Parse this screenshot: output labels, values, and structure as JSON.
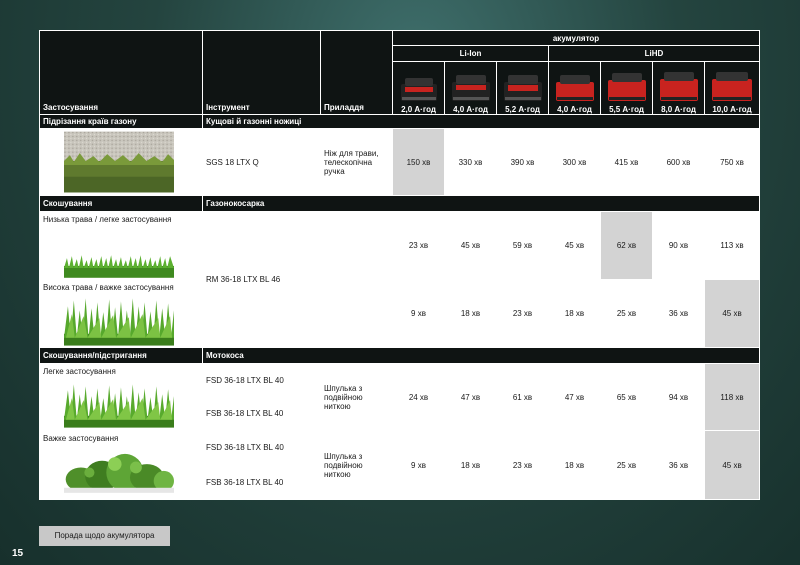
{
  "header": {
    "battery_group": "акумулятор",
    "liion": "Li-Ion",
    "lihd": "LiHD",
    "col_application": "Застосування",
    "col_tool": "Інструмент",
    "col_accessory": "Приладдя",
    "capacities": [
      "2,0 А·год",
      "4,0 А·год",
      "5,2 А·год",
      "4,0 А·год",
      "5,5 А·год",
      "8,0 А·год",
      "10,0 А·год"
    ]
  },
  "sections": {
    "s1": {
      "title": "Підрізання країв газону",
      "tool_group": "Кущові й газонні ножиці"
    },
    "s2": {
      "title": "Скошування",
      "tool_group": "Газонокосарка"
    },
    "s3": {
      "title": "Скошування/підстригання",
      "tool_group": "Мотокоса"
    }
  },
  "rows": {
    "r1": {
      "tool": "SGS 18 LTX Q",
      "accessory": "Ніж для трави, телескопічна ручка",
      "values": [
        "150 хв",
        "330 хв",
        "390 хв",
        "300 хв",
        "415 хв",
        "600 хв",
        "750 хв"
      ]
    },
    "r2": {
      "label": "Низька трава / легке застосування",
      "values": [
        "23 хв",
        "45 хв",
        "59 хв",
        "45 хв",
        "62 хв",
        "90 хв",
        "113 хв"
      ]
    },
    "r3": {
      "label": "Висока трава / важке застосування",
      "values": [
        "9 хв",
        "18 хв",
        "23 хв",
        "18 хв",
        "25 хв",
        "36 хв",
        "45 хв"
      ]
    },
    "mower_tool": "RM 36-18 LTX BL 46",
    "r4": {
      "label": "Легке застосування",
      "tool_a": "FSD 36-18 LTX BL 40",
      "tool_b": "FSB 36-18 LTX BL 40",
      "accessory": "Шпулька з подвійною ниткою",
      "values": [
        "24 хв",
        "47 хв",
        "61 хв",
        "47 хв",
        "65 хв",
        "94 хв",
        "118 хв"
      ]
    },
    "r5": {
      "label": "Важке застосування",
      "tool_a": "FSD 36-18 LTX BL 40",
      "tool_b": "FSB 36-18 LTX BL 40",
      "accessory": "Шпулька з подвійною ниткою",
      "values": [
        "9 хв",
        "18 хв",
        "23 хв",
        "18 хв",
        "25 хв",
        "36 хв",
        "45 хв"
      ]
    }
  },
  "footer": {
    "page_number": "15",
    "tip_button": "Порада щодо акумулятора"
  },
  "colors": {
    "highlight": "#d3d3d3",
    "header_dark": "#0f1413",
    "battery_red": "#c8231f"
  }
}
